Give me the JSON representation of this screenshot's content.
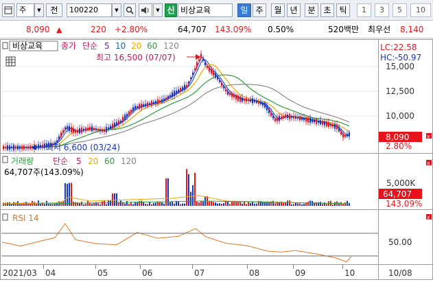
{
  "toolbar": {
    "type_label": "주",
    "tab_jeon": "전",
    "code": "100220",
    "sin_label": "신",
    "stock_name": "비상교육",
    "periods": [
      "일",
      "주",
      "월",
      "년",
      "분",
      "초",
      "틱"
    ],
    "active_period": "일",
    "intervals": [
      "1",
      "3",
      "5",
      "10"
    ]
  },
  "quote": {
    "price": "8,090",
    "change_arrow": "▲",
    "change": "220",
    "change_pct": "+2.80%",
    "volume": "64,707",
    "vol_ratio": "143.09%",
    "turnover": "0.50%",
    "trade_value": "520백만",
    "best_label": "최우선",
    "best_price": "8,140"
  },
  "price_pane": {
    "stock_tag": "비상교육",
    "legend_close": "종가",
    "legend_ma_type": "단순",
    "legend_periods": [
      "5",
      "10",
      "20",
      "60",
      "120"
    ],
    "high_note": "최고 16,500 (07/07)",
    "low_note": "최저 6,600 (03/24)",
    "lc_label": "LC:22.58",
    "hc_label": "HC:-50.97",
    "y_ticks": [
      "15,000",
      "12,500",
      "10,000"
    ],
    "price_tag": "8,090",
    "pct_tag": "2.80%"
  },
  "volume_pane": {
    "title": "거래량",
    "ma_type": "단순",
    "periods": [
      "5",
      "20",
      "60",
      "120"
    ],
    "summary": "64,707주(143.09%)",
    "y_tick": "5,000K",
    "vol_tag": "64,707",
    "pct_tag": "143.09%"
  },
  "rsi_pane": {
    "title": "RSI 14",
    "y_tick": "50.00"
  },
  "x_axis": [
    "2021/03",
    "04",
    "05",
    "06",
    "07",
    "08",
    "09",
    "10",
    "10/08"
  ],
  "colors": {
    "up": "#e8141c",
    "down": "#1434c8",
    "ma5": "#7b1fa2",
    "ma10": "#1565c0",
    "ma20": "#f0a800",
    "ma60": "#2e9d3b",
    "ma120": "#8a8a8a",
    "rsi": "#e8731c"
  }
}
